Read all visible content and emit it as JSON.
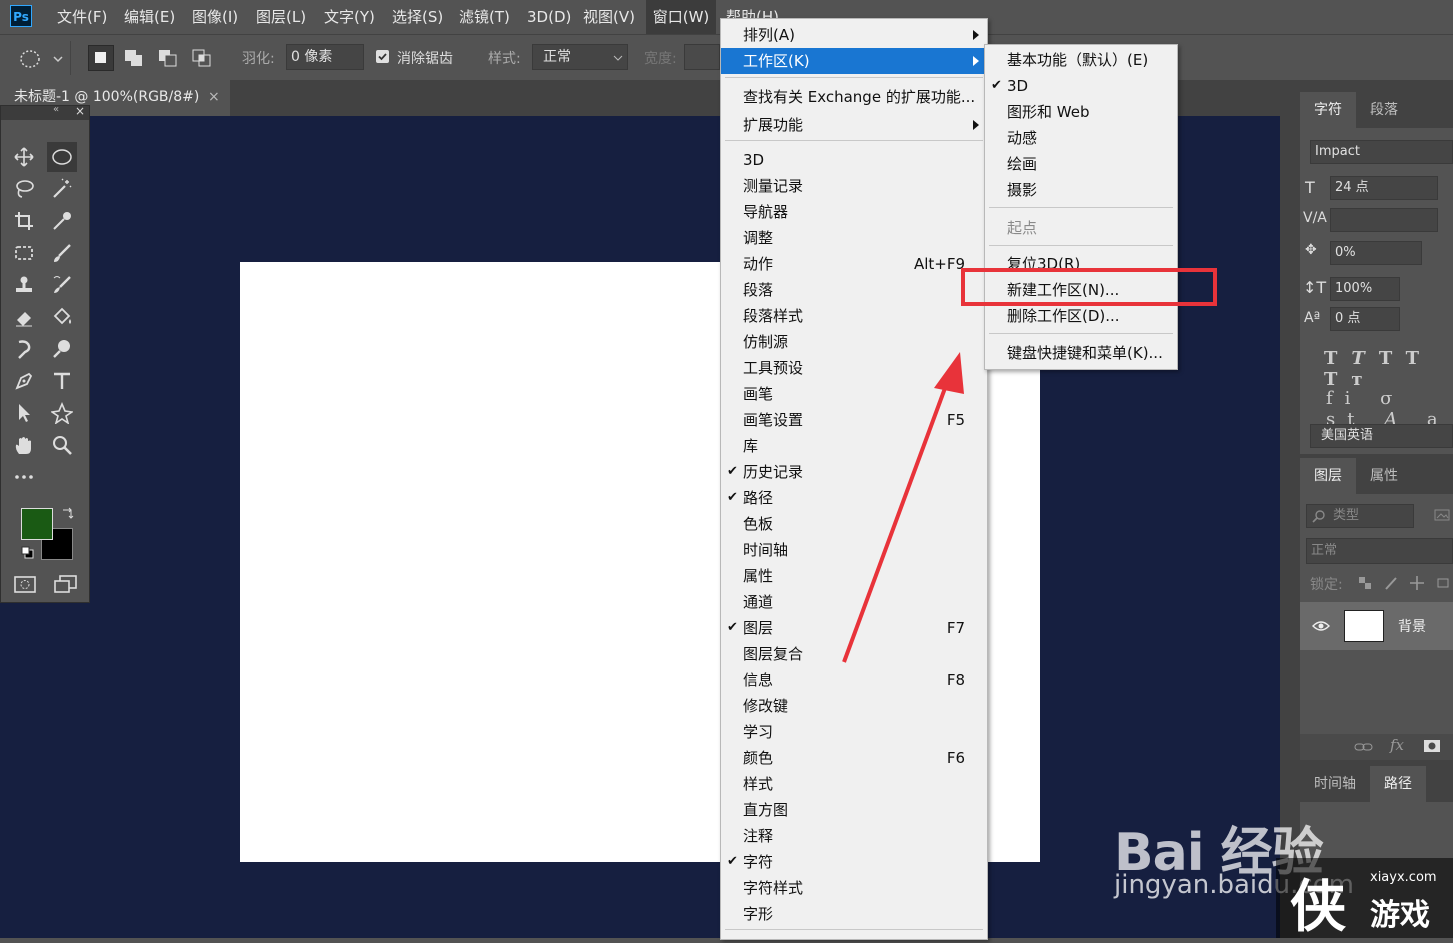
{
  "app": {
    "logo": "Ps"
  },
  "menubar": {
    "items": [
      "文件(F)",
      "编辑(E)",
      "图像(I)",
      "图层(L)",
      "文字(Y)",
      "选择(S)",
      "滤镜(T)",
      "3D(D)",
      "视图(V)",
      "窗口(W)",
      "帮助(H)"
    ]
  },
  "options": {
    "feather_label": "羽化:",
    "feather_value": "0 像素",
    "antialias_label": "消除锯齿",
    "style_label": "样式:",
    "style_value": "正常",
    "width_label": "宽度:"
  },
  "document": {
    "tab_title": "未标题-1 @ 100%(RGB/8#)",
    "close": "×"
  },
  "colors": {
    "foreground": "#1a5a14",
    "background": "#000000",
    "canvas": "#161f40",
    "highlight": "#1976d2",
    "annotation": "#e8333a"
  },
  "window_menu": {
    "items": [
      {
        "label": "排列(A)",
        "arrow": true
      },
      {
        "label": "工作区(K)",
        "arrow": true,
        "highlight": true
      },
      {
        "label": "查找有关 Exchange 的扩展功能..."
      },
      {
        "label": "扩展功能",
        "arrow": true
      },
      {
        "label": "3D"
      },
      {
        "label": "测量记录"
      },
      {
        "label": "导航器"
      },
      {
        "label": "调整"
      },
      {
        "label": "动作",
        "shortcut": "Alt+F9"
      },
      {
        "label": "段落"
      },
      {
        "label": "段落样式"
      },
      {
        "label": "仿制源"
      },
      {
        "label": "工具预设"
      },
      {
        "label": "画笔"
      },
      {
        "label": "画笔设置",
        "shortcut": "F5"
      },
      {
        "label": "库"
      },
      {
        "label": "历史记录",
        "checked": true
      },
      {
        "label": "路径",
        "checked": true
      },
      {
        "label": "色板"
      },
      {
        "label": "时间轴"
      },
      {
        "label": "属性"
      },
      {
        "label": "通道"
      },
      {
        "label": "图层",
        "shortcut": "F7",
        "checked": true
      },
      {
        "label": "图层复合"
      },
      {
        "label": "信息",
        "shortcut": "F8"
      },
      {
        "label": "修改键"
      },
      {
        "label": "学习"
      },
      {
        "label": "颜色",
        "shortcut": "F6"
      },
      {
        "label": "样式"
      },
      {
        "label": "直方图"
      },
      {
        "label": "注释"
      },
      {
        "label": "字符",
        "checked": true
      },
      {
        "label": "字符样式"
      },
      {
        "label": "字形"
      }
    ]
  },
  "workspace_menu": {
    "items": [
      {
        "label": "基本功能（默认）(E)"
      },
      {
        "label": "3D",
        "checked": true
      },
      {
        "label": "图形和 Web"
      },
      {
        "label": "动感"
      },
      {
        "label": "绘画"
      },
      {
        "label": "摄影"
      },
      {
        "label": "起点",
        "disabled": true
      },
      {
        "label": "复位3D(R)"
      },
      {
        "label": "新建工作区(N)..."
      },
      {
        "label": "删除工作区(D)..."
      },
      {
        "label": "键盘快捷键和菜单(K)..."
      }
    ]
  },
  "character_panel": {
    "tabs": [
      "字符",
      "段落"
    ],
    "font": "Impact",
    "size": "24 点",
    "scale": "0%",
    "vertical": "100%",
    "baseline": "0 点",
    "language": "美国英语"
  },
  "layers_panel": {
    "tabs": [
      "图层",
      "属性"
    ],
    "filter_placeholder": "类型",
    "blend_mode": "正常",
    "lock_label": "锁定:",
    "layer_name": "背景"
  },
  "bottom_tabs": [
    "时间轴",
    "路径"
  ],
  "watermark": {
    "baidu": "Bai 经验",
    "url": "jingyan.baidu.com",
    "site": "xiayx.com",
    "game": "游戏"
  }
}
